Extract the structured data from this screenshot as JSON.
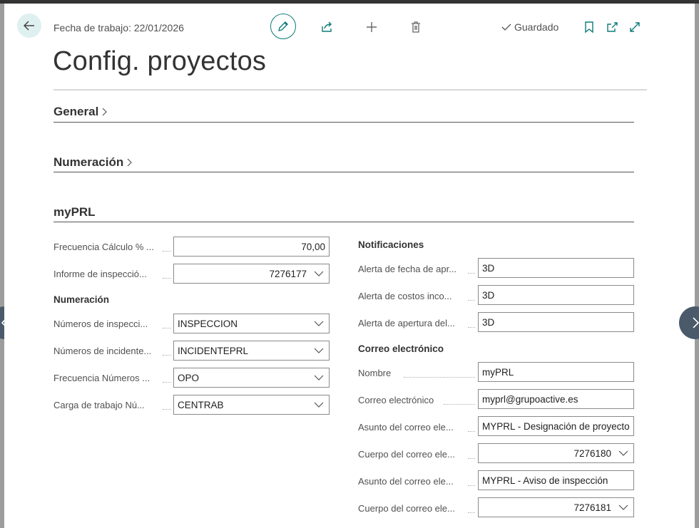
{
  "header": {
    "work_date": "Fecha de trabajo: 22/01/2026",
    "saved_label": "Guardado",
    "title": "Config. proyectos"
  },
  "sections": {
    "general": "General",
    "numeracion": "Numeración",
    "myprl": "myPRL"
  },
  "left": {
    "fields": [
      {
        "label": "Frecuencia Cálculo % ...",
        "value": "70,00"
      },
      {
        "label": "Informe de inspecció...",
        "value": "7276177"
      }
    ],
    "group_numeracion": "Numeración",
    "numeracion_fields": [
      {
        "label": "Números de inspecci...",
        "value": "INSPECCION"
      },
      {
        "label": "Números de incidente...",
        "value": "INCIDENTEPRL"
      },
      {
        "label": "Frecuencia Números ...",
        "value": "OPO"
      },
      {
        "label": "Carga de trabajo Nú...",
        "value": "CENTRAB"
      }
    ]
  },
  "right": {
    "group_notificaciones": "Notificaciones",
    "notificaciones_fields": [
      {
        "label": "Alerta de fecha de apr...",
        "value": "3D"
      },
      {
        "label": "Alerta de costos inco...",
        "value": "3D"
      },
      {
        "label": "Alerta de apertura del...",
        "value": "3D"
      }
    ],
    "group_correo": "Correo electrónico",
    "correo_fields": [
      {
        "label": "Nombre",
        "value": "myPRL"
      },
      {
        "label": "Correo electrónico",
        "value": "myprl@grupoactive.es"
      },
      {
        "label": "Asunto del correo ele...",
        "value": "MYPRL - Designación de proyecto"
      },
      {
        "label": "Cuerpo del correo ele...",
        "value": "7276180"
      },
      {
        "label": "Asunto del correo ele...",
        "value": "MYPRL - Aviso de inspección"
      },
      {
        "label": "Cuerpo del correo ele...",
        "value": "7276181"
      }
    ]
  },
  "colors": {
    "accent": "#0e7a7a",
    "nav_arrow": "#4a5a6a"
  }
}
